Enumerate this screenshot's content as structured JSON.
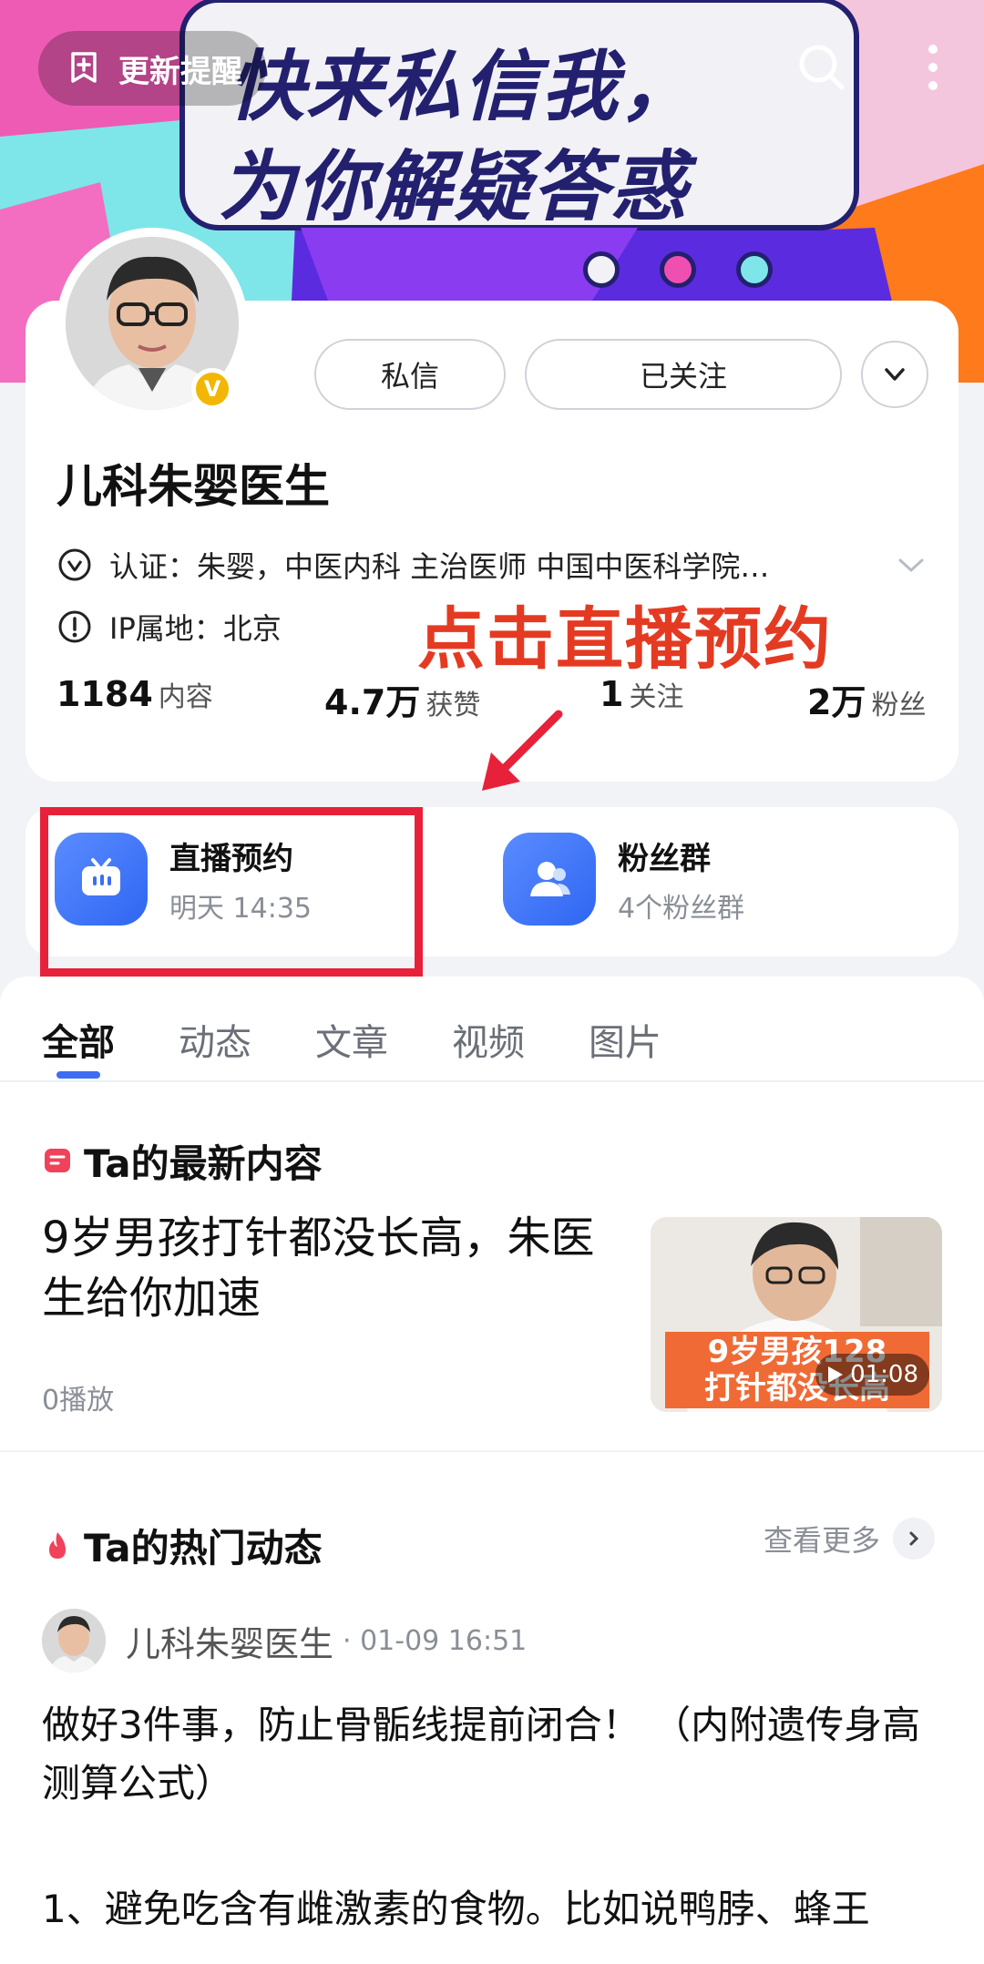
{
  "banner": {
    "line1": "快来私信我，",
    "line2": "为你解疑答惑",
    "update_button": "更新提醒"
  },
  "profile": {
    "name": "儿科朱婴医生",
    "dm_button": "私信",
    "follow_button": "已关注",
    "cert_text": "认证：朱婴，中医内科 主治医师 中国中医科学院…",
    "ip_text": "IP属地：北京",
    "stats": [
      {
        "value": "1184",
        "label": "内容"
      },
      {
        "value": "4.7万",
        "label": "获赞"
      },
      {
        "value": "1",
        "label": "关注"
      },
      {
        "value": "2万",
        "label": "粉丝"
      }
    ]
  },
  "annotation": "点击直播预约",
  "services": {
    "live": {
      "title": "直播预约",
      "sub": "明天 14:35"
    },
    "fans": {
      "title": "粉丝群",
      "sub": "4个粉丝群"
    }
  },
  "tabs": [
    "全部",
    "动态",
    "文章",
    "视频",
    "图片"
  ],
  "latest": {
    "heading": "Ta的最新内容",
    "title": "9岁男孩打针都没长高，朱医生给你加速",
    "plays": "0播放",
    "thumb_caption_1": "9岁男孩128",
    "thumb_caption_2": "打针都没长高",
    "duration": "01:08"
  },
  "hot": {
    "heading": "Ta的热门动态",
    "more": "查看更多",
    "author": "儿科朱婴医生",
    "date": "· 01-09 16:51",
    "title": "做好3件事，防止骨骺线提前闭合！ （内附遗传身高测算公式）",
    "body": "1、避免吃含有雌激素的食物。比如说鸭脖、蜂王"
  },
  "colors": {
    "accent_blue": "#3d6df2",
    "annotation_red": "#e53a22",
    "highlight_red": "#e8213a",
    "banner_navy": "#23206f"
  }
}
